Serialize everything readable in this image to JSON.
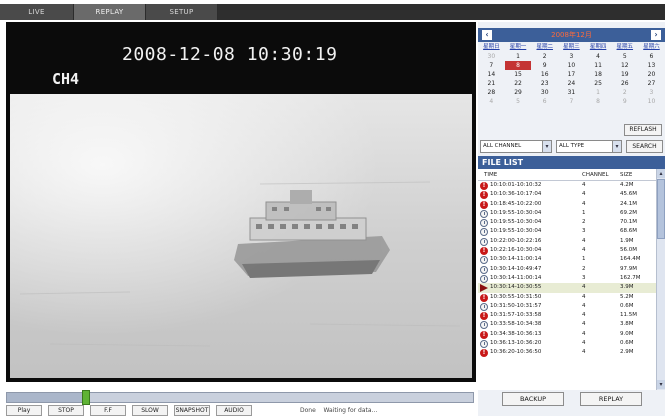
{
  "tabs": [
    {
      "label": "LIVE",
      "active": false
    },
    {
      "label": "REPLAY",
      "active": true
    },
    {
      "label": "SETUP",
      "active": false
    }
  ],
  "video": {
    "timestamp": "2008-12-08  10:30:19",
    "channel": "CH4"
  },
  "playback": {
    "progress_fraction": 0.17,
    "buttons": [
      "Play",
      "STOP",
      "F.F",
      "SLOW",
      "SNAPSHOT",
      "AUDIO"
    ],
    "status_label": "Done",
    "status_text": "Waiting for data..."
  },
  "calendar": {
    "prev_icon": "‹",
    "next_icon": "›",
    "title": "2008年12月",
    "weekdays": [
      "星期日",
      "星期一",
      "星期二",
      "星期三",
      "星期四",
      "星期五",
      "星期六"
    ],
    "weeks": [
      [
        {
          "d": "30",
          "o": true
        },
        {
          "d": "1"
        },
        {
          "d": "2"
        },
        {
          "d": "3"
        },
        {
          "d": "4"
        },
        {
          "d": "5"
        },
        {
          "d": "6"
        }
      ],
      [
        {
          "d": "7"
        },
        {
          "d": "8",
          "s": true
        },
        {
          "d": "9"
        },
        {
          "d": "10"
        },
        {
          "d": "11"
        },
        {
          "d": "12"
        },
        {
          "d": "13"
        }
      ],
      [
        {
          "d": "14"
        },
        {
          "d": "15"
        },
        {
          "d": "16"
        },
        {
          "d": "17"
        },
        {
          "d": "18"
        },
        {
          "d": "19"
        },
        {
          "d": "20"
        }
      ],
      [
        {
          "d": "21"
        },
        {
          "d": "22"
        },
        {
          "d": "23"
        },
        {
          "d": "24"
        },
        {
          "d": "25"
        },
        {
          "d": "26"
        },
        {
          "d": "27"
        }
      ],
      [
        {
          "d": "28"
        },
        {
          "d": "29"
        },
        {
          "d": "30"
        },
        {
          "d": "31"
        },
        {
          "d": "1",
          "o": true
        },
        {
          "d": "2",
          "o": true
        },
        {
          "d": "3",
          "o": true
        }
      ],
      [
        {
          "d": "4",
          "o": true
        },
        {
          "d": "5",
          "o": true
        },
        {
          "d": "6",
          "o": true
        },
        {
          "d": "7",
          "o": true
        },
        {
          "d": "8",
          "o": true
        },
        {
          "d": "9",
          "o": true
        },
        {
          "d": "10",
          "o": true
        }
      ]
    ],
    "selected_day": "8"
  },
  "refresh_label": "REFLASH",
  "filters": {
    "channel": "ALL CHANNEL",
    "type": "ALL TYPE",
    "search_label": "SEARCH"
  },
  "file_list": {
    "title": "FILE LIST",
    "headers": {
      "time": "TIME",
      "channel": "CHANNEL",
      "size": "SIZE"
    },
    "rows": [
      {
        "icon": "alarm",
        "time": "10:10:01-10:10:32",
        "channel": "4",
        "size": "4.2M"
      },
      {
        "icon": "alarm",
        "time": "10:10:36-10:17:04",
        "channel": "4",
        "size": "45.6M"
      },
      {
        "icon": "alarm",
        "time": "10:18:45-10:22:00",
        "channel": "4",
        "size": "24.1M"
      },
      {
        "icon": "normal",
        "time": "10:19:55-10:30:04",
        "channel": "1",
        "size": "69.2M"
      },
      {
        "icon": "normal",
        "time": "10:19:55-10:30:04",
        "channel": "2",
        "size": "70.1M"
      },
      {
        "icon": "normal",
        "time": "10:19:55-10:30:04",
        "channel": "3",
        "size": "68.6M"
      },
      {
        "icon": "normal",
        "time": "10:22:00-10:22:16",
        "channel": "4",
        "size": "1.9M"
      },
      {
        "icon": "alarm",
        "time": "10:22:16-10:30:04",
        "channel": "4",
        "size": "56.0M"
      },
      {
        "icon": "normal",
        "time": "10:30:14-11:00:14",
        "channel": "1",
        "size": "164.4M"
      },
      {
        "icon": "normal",
        "time": "10:30:14-10:49:47",
        "channel": "2",
        "size": "97.9M"
      },
      {
        "icon": "normal",
        "time": "10:30:14-11:00:14",
        "channel": "3",
        "size": "162.7M"
      },
      {
        "icon": "playing",
        "time": "10:30:14-10:30:55",
        "channel": "4",
        "size": "3.9M"
      },
      {
        "icon": "alarm",
        "time": "10:30:55-10:31:50",
        "channel": "4",
        "size": "5.2M"
      },
      {
        "icon": "normal",
        "time": "10:31:50-10:31:57",
        "channel": "4",
        "size": "0.6M"
      },
      {
        "icon": "alarm",
        "time": "10:31:57-10:33:58",
        "channel": "4",
        "size": "11.5M"
      },
      {
        "icon": "normal",
        "time": "10:33:58-10:34:38",
        "channel": "4",
        "size": "3.8M"
      },
      {
        "icon": "alarm",
        "time": "10:34:38-10:36:13",
        "channel": "4",
        "size": "9.0M"
      },
      {
        "icon": "normal",
        "time": "10:36:13-10:36:20",
        "channel": "4",
        "size": "0.6M"
      },
      {
        "icon": "alarm",
        "time": "10:36:20-10:36:50",
        "channel": "4",
        "size": "2.9M"
      }
    ]
  },
  "actions": {
    "backup_label": "BACKUP",
    "replay_label": "REPLAY"
  },
  "colors": {
    "header_blue": "#3c5f99",
    "selected_day": "#c43434",
    "alarm_red": "#c81818",
    "progress_handle": "#5fb335"
  }
}
